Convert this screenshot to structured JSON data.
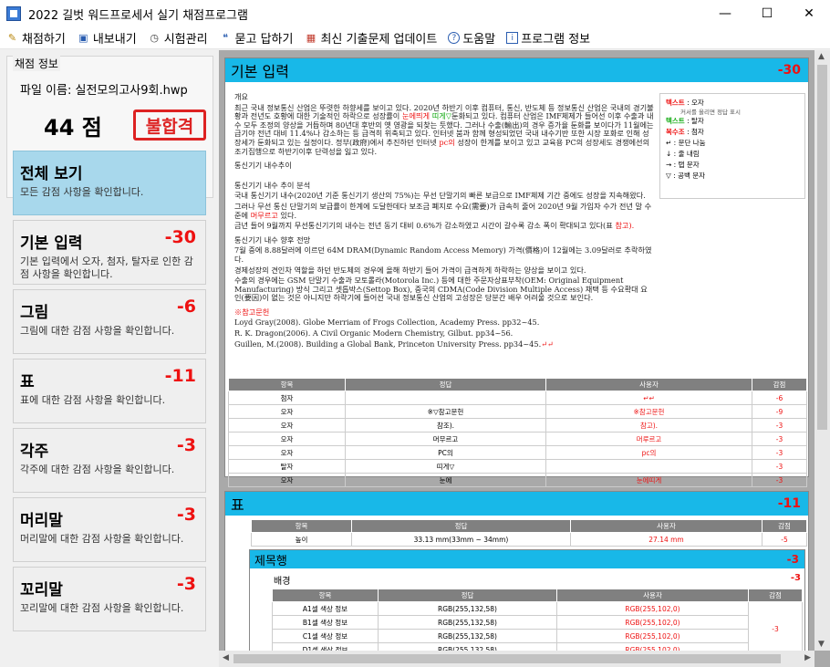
{
  "window": {
    "title": "2022 길벗 워드프로세서 실기 채점프로그램"
  },
  "menu": [
    {
      "label": "채점하기",
      "icon": "pencil-icon",
      "glyph": "✎",
      "color": "#b8860b"
    },
    {
      "label": "내보내기",
      "icon": "save-icon",
      "glyph": "▣",
      "color": "#2a5db0"
    },
    {
      "label": "시험관리",
      "icon": "stopwatch-icon",
      "glyph": "◷",
      "color": "#444"
    },
    {
      "label": "묻고 답하기",
      "icon": "chat-icon",
      "glyph": "❝",
      "color": "#2a5db0"
    },
    {
      "label": "최신 기출문제 업데이트",
      "icon": "gift-icon",
      "glyph": "▦",
      "color": "#c0392b"
    },
    {
      "label": "도움말",
      "icon": "help-icon",
      "glyph": "?",
      "color": "#2a5db0"
    },
    {
      "label": "프로그램 정보",
      "icon": "info-icon",
      "glyph": "i",
      "color": "#2a5db0"
    }
  ],
  "info": {
    "legend": "채점 정보",
    "file_label": "파일 이름: 실전모의고사9회.hwp",
    "score": "44 점",
    "result": "불합격"
  },
  "categories": [
    {
      "title": "전체 보기",
      "score": "",
      "desc": "모든 감점 사항을 확인합니다.",
      "active": true
    },
    {
      "title": "기본 입력",
      "score": "-30",
      "desc": "기본 입력에서 오자, 첨자, 탈자로 인한 감점 사항을 확인합니다."
    },
    {
      "title": "그림",
      "score": "-6",
      "desc": "그림에 대한 감점 사항을 확인합니다."
    },
    {
      "title": "표",
      "score": "-11",
      "desc": "표에 대한 감점 사항을 확인합니다."
    },
    {
      "title": "각주",
      "score": "-3",
      "desc": "각주에 대한 감점 사항을 확인합니다."
    },
    {
      "title": "머리말",
      "score": "-3",
      "desc": "머리말에 대한 감점 사항을 확인합니다."
    },
    {
      "title": "꼬리말",
      "score": "-3",
      "desc": "꼬리말에 대한 감점 사항을 확인합니다."
    }
  ],
  "basic_card": {
    "title": "기본 입력",
    "score": "-30",
    "doc": {
      "p1": "개요",
      "p2": "최근 국내 정보통신 산업은 뚜렷한 하향세를 보이고 있다. 2020년 하반기 이후 컴퓨터, 통신, 반도체 등 정보통신 산업은 국내의 경기불황과 전년도 호황에 대한 기술적인 하락으로 성장률이",
      "p2_mark1": "눈에띄게",
      "p2_mark2": "띠게▽",
      "p2b": "둔화되고 있다. 컴퓨터 산업은 IMF체제가 들어선 이후 수출과 내수 모두 조정의 양상을 거듭하며 80년대 후반의 옛 영광을 되찾는 듯했다. 그러나 수출(輸出)의 경우 증가율 둔화를 보이다가 11월에는 급기야 전년 대비 11.4%나 감소하는 등 급격히 위축되고 있다. 인터넷 붐과 함께 형성되었던 국내 내수기반 또한 시장 포화로 인해 성장세가 둔화되고 있는 실정이다. 정부(政府)에서 추진하던 인터넷",
      "p2_mark3": "pc의",
      "p2c": "성장이 한계를 보이고 있고 교육용 PC의 성장세도 경쟁에선의 조기집행으로 하반기이후 단력성을 잃고 있다.",
      "p3": "통신기기 내수추이",
      "p4": "통신기기 내수 추이 분석",
      "p5": "국내 통신기기 내수(2020년 기준 통신기기 생산의 75%)는 무선 단말기의 빠른 보급으로 IMF체제 기간 중에도 성장을 지속해왔다.",
      "p6": "그러나 무선 통신 단말기의 보급률이 한계에 도달한데다 보조금 폐지로 수요(需要)가 급속히 줄어 2020년 9월 가입자 수가 전년 말 수준에",
      "p6_mark": "머무르고",
      "p6b": "있다.",
      "p7": "금년 들어 9월까지 무선통신기기의 내수는 전년 동기 대비 0.6%가 감소하였고 시간이 갈수록 감소 폭이 확대되고 있다(표",
      "p7_mark": "참고).",
      "p8": "통신기기 내수 향후 전망",
      "p9": "7월 중에 8.88달러에 이르던 64M DRAM(Dynamic Random Access Memory) 가격(價格)이 12월에는 3.09달러로 추락하였다.",
      "p10": "경제성장의 견인차 역할을 하던 반도체의 경우에 올해 하반기 들어 가격이 급격하게 하락하는 양상을 보이고 있다.",
      "p11": "수출의 경우에는 GSM 단말기 수출과 모토롤라(Motorola Inc.) 등에 대한 주문자상표부착(OEM: Original Equipment Manufacturing) 방식 그리고 셋톱박스(Settop Box), 중국의 CDMA(Code Division Multiple Access) 채택 등 수요확대 요인(要因)이 없는 것은 아니지만 하락기에 들어선 국내 정보통신 산업의 고성장은 당분간 배우 어려울 것으로 보인다.",
      "ref_title": "※참고문헌",
      "ref1": "Loyd Gray(2008). Globe Merriam of Frogs Collection, Academy Press. pp32~45.",
      "ref2": "R. K. Dragon(2006). A Civil Organic Modern Chemistry, Gilbut. pp34~56.",
      "ref3": "Guillen, M.(2008). Building a Global Bank, Princeton University Press. pp34~45.",
      "ref3_mark": "↵↵"
    },
    "legend": {
      "l1a": "텍스트",
      "l1b": ": 오자",
      "l1c": "커서를 올리면 정답 표시",
      "l2a": "텍스트",
      "l2b": ": 탈자",
      "l3a": "복수조",
      "l3b": ": 첨자",
      "l4": "↵ : 문단 나눔",
      "l5": "↓ : 줄 내림",
      "l6": "→ : 탭 문자",
      "l7": "▽ : 공백 문자"
    },
    "table": {
      "headers": [
        "항목",
        "정답",
        "사용자",
        "감점"
      ],
      "rows": [
        [
          "첨자",
          "",
          "↵↵",
          "-6"
        ],
        [
          "오자",
          "※▽참고문헌",
          "※참고문헌",
          "-9"
        ],
        [
          "오자",
          "참조).",
          "참고).",
          "-3"
        ],
        [
          "오자",
          "머무르고",
          "머루르고",
          "-3"
        ],
        [
          "오자",
          "PC의",
          "pc의",
          "-3"
        ],
        [
          "탈자",
          "띠게▽",
          "",
          "-3"
        ],
        [
          "오자",
          "눈에",
          "눈에띠게",
          "-3"
        ]
      ]
    }
  },
  "table_card": {
    "title": "표",
    "score": "-11",
    "table": {
      "headers": [
        "항목",
        "정답",
        "사용자",
        "감점"
      ],
      "rows": [
        [
          "높이",
          "33.13 mm(33mm ~ 34mm)",
          "27.14 mm",
          "-5"
        ]
      ]
    },
    "sub": {
      "title": "제목행",
      "score": "-3",
      "section": "배경",
      "section_score": "-3",
      "headers": [
        "항목",
        "정답",
        "사용자",
        "감점"
      ],
      "rows": [
        [
          "A1셀 색상 정보",
          "RGB(255,132,58)",
          "RGB(255,102,0)",
          "-3"
        ],
        [
          "B1셀 색상 정보",
          "RGB(255,132,58)",
          "RGB(255,102,0)",
          ""
        ],
        [
          "C1셀 색상 정보",
          "RGB(255,132,58)",
          "RGB(255,102,0)",
          ""
        ],
        [
          "D1셀 색상 정보",
          "RGB(255,132,58)",
          "RGB(255,102,0)",
          ""
        ]
      ]
    }
  }
}
